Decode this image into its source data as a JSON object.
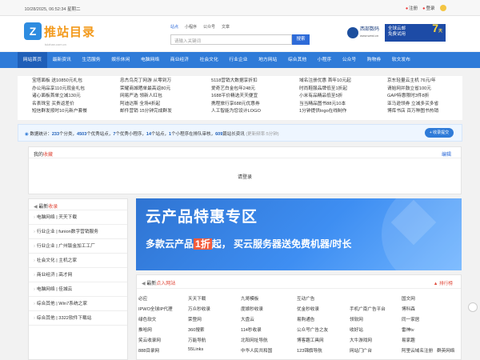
{
  "topbar": {
    "date": "10/28/2025, 06:52:34 星期二",
    "register": "注册",
    "login": "登录"
  },
  "logo": {
    "mark": "Z",
    "text": "推站目录",
    "sub": "tuizhan.com.cn"
  },
  "search": {
    "tabs": [
      "站点",
      "小程序",
      "公众号",
      "文章"
    ],
    "placeholder": "请输入关键词",
    "button": "搜索"
  },
  "ads": {
    "west_name": "西部数码",
    "west_url": "www.west.cn",
    "cloud_line1": "全球云邮",
    "cloud_line2": "免费试用",
    "cloud_big": "7",
    "cloud_unit": "天"
  },
  "nav": [
    "网站首页",
    "最新资讯",
    "生活服务",
    "娱乐休闲",
    "电脑网络",
    "商业经济",
    "社会文化",
    "行业企业",
    "地方网站",
    "综合其他",
    "小程序",
    "公众号",
    "购物券",
    "软文发布"
  ],
  "hotlinks": [
    [
      "宝塔面板 送10850元礼包",
      "办公用品享110元现金礼包",
      "诸心面板首单立减130元",
      "名表珠宝 买贵返差价",
      "短信群发按时10元新户套餐"
    ],
    [
      "忠杰鸟克丁网游 从零到万",
      "荣耀商城晒单最高返80元",
      "网易严选 领新人红包",
      "阿迪达斯 全场4折起",
      "邮件营销 15分钟完成群发"
    ],
    [
      "5118营销大数据享折扣",
      "爱奇艺白金包年248元",
      "1688平价精选天天便宜",
      "携程旅行享688元优惠券",
      "人工智能为您设计LOGO"
    ],
    [
      "域名注册优惠 首年10元起",
      "时尚鞋服品牌低至1折起",
      "小米有品精品低至5折",
      "当当精品图书88元10本",
      "1分钟提供logo在线制作"
    ],
    [
      "京东轻量云主机 76元/年",
      "请始网并鼓立省100元",
      "GAP特惠限时3件8折",
      "亚马逊领券 立减多买多省",
      "博库书店 百万种图书热销"
    ]
  ],
  "stats": {
    "label": "数据统计：",
    "sites": "233",
    "sites_unit": "个分类，",
    "quality": "4503",
    "quality_unit": "个优秀站点，",
    "miniapps": "7",
    "miniapps_unit": "个优秀小程序，",
    "mp": "14",
    "mp_unit": "个站点，",
    "pending": "1",
    "pending_unit": "个小程序在排队审核，",
    "articles": "609",
    "articles_unit": "篇站长资讯",
    "updated": "(更新频率:5分钟)",
    "submit": "+ 收录提交"
  },
  "favorites": {
    "title_prefix": "我的",
    "title_hl": "收藏",
    "edit": "编辑",
    "login_hint": "请登录"
  },
  "latest": {
    "title_prefix": "最新",
    "title_hl": "收录",
    "items": [
      "电脑网络 | 天天下载",
      "行业企业 | funion数字营销服务",
      "行业企业 | 广州钣金加工工厂",
      "社会文化 | 主机之家",
      "商业经济 | 高才网",
      "电脑网络 | 佳城云",
      "综合其他 | Win7系统之家",
      "综合其他 | 3322软件下载站"
    ]
  },
  "banner": {
    "title": "云产品特惠专区",
    "sub_a": "多款云产品",
    "sub_hl": "1折",
    "sub_b": "起， 买云服务器送免费机器/时长"
  },
  "hotsites": {
    "title_prefix": "最新",
    "title_hl": "点入网站",
    "ranking": "排行榜",
    "rows": [
      [
        "必应",
        "天天下载",
        "九哥模板",
        "互动广告",
        "国文网"
      ],
      [
        "IPWO全球IP代理",
        "万众秒收录",
        "度娘秒收录",
        "优金秒收录",
        "手机广南广告平台",
        "博科森"
      ],
      [
        "绿色软文",
        "荣登网",
        "大盘云",
        "易购通告",
        "领软网",
        "同一家居"
      ],
      [
        "推哈网",
        "360搜索",
        "114秒收录",
        "公众号广告之友",
        "收好站",
        "雷神tv"
      ],
      [
        "笑云收录网",
        "万能导航",
        "北阳网址导航",
        "博客趣工具网",
        "大牛游戏网",
        "易家趣"
      ],
      [
        "888目录网",
        "55Links",
        "中华人民共和国",
        "123锦旗导航",
        "网站门广台",
        "阿里云域名注册",
        "群英网络"
      ]
    ]
  },
  "colors": {
    "nav_bg": "#2f7bd8",
    "accent_red": "#e04a3b",
    "logo_orange": "#f39a1c"
  }
}
